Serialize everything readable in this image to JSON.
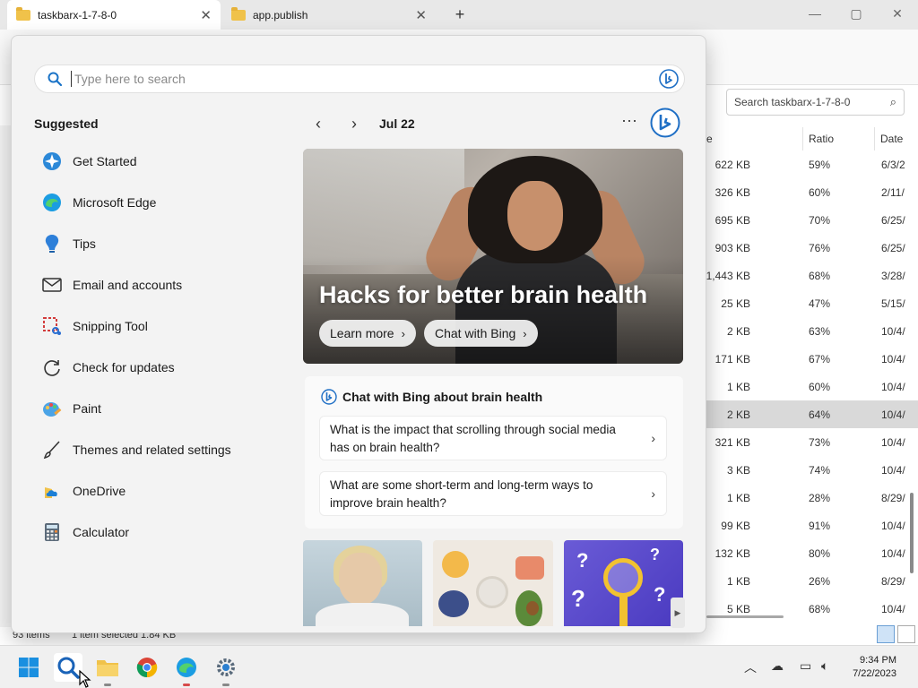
{
  "window": {
    "tabs": [
      {
        "label": "taskbarx-1-7-8-0",
        "close": "✕"
      },
      {
        "label": "app.publish",
        "close": "✕"
      }
    ],
    "new_tab": "+",
    "controls": {
      "minimize": "—",
      "maximize": "▢",
      "close": "✕"
    }
  },
  "explorer": {
    "search_placeholder": "Search taskbarx-1-7-8-0",
    "columns": {
      "size_fragment": "e",
      "ratio": "Ratio",
      "date": "Date"
    },
    "rows": [
      {
        "size": "622 KB",
        "ratio": "59%",
        "date": "6/3/2"
      },
      {
        "size": "326 KB",
        "ratio": "60%",
        "date": "2/11/"
      },
      {
        "size": "695 KB",
        "ratio": "70%",
        "date": "6/25/"
      },
      {
        "size": "903 KB",
        "ratio": "76%",
        "date": "6/25/"
      },
      {
        "size": "1,443 KB",
        "ratio": "68%",
        "date": "3/28/"
      },
      {
        "size": "25 KB",
        "ratio": "47%",
        "date": "5/15/"
      },
      {
        "size": "2 KB",
        "ratio": "63%",
        "date": "10/4/"
      },
      {
        "size": "171 KB",
        "ratio": "67%",
        "date": "10/4/"
      },
      {
        "size": "1 KB",
        "ratio": "60%",
        "date": "10/4/"
      },
      {
        "size": "2 KB",
        "ratio": "64%",
        "date": "10/4/"
      },
      {
        "size": "321 KB",
        "ratio": "73%",
        "date": "10/4/"
      },
      {
        "size": "3 KB",
        "ratio": "74%",
        "date": "10/4/"
      },
      {
        "size": "1 KB",
        "ratio": "28%",
        "date": "8/29/"
      },
      {
        "size": "99 KB",
        "ratio": "91%",
        "date": "10/4/"
      },
      {
        "size": "132 KB",
        "ratio": "80%",
        "date": "10/4/"
      },
      {
        "size": "1 KB",
        "ratio": "26%",
        "date": "8/29/"
      },
      {
        "size": "5 KB",
        "ratio": "68%",
        "date": "10/4/"
      }
    ],
    "status": {
      "items": "93 items",
      "selected": "1 item selected  1.84 KB"
    }
  },
  "search": {
    "placeholder": "Type here to search",
    "suggested_title": "Suggested",
    "apps": [
      {
        "name": "Get Started",
        "icon": "get-started-icon"
      },
      {
        "name": "Microsoft Edge",
        "icon": "edge-icon"
      },
      {
        "name": "Tips",
        "icon": "tips-icon"
      },
      {
        "name": "Email and accounts",
        "icon": "mail-icon"
      },
      {
        "name": "Snipping Tool",
        "icon": "snipping-tool-icon"
      },
      {
        "name": "Check for updates",
        "icon": "refresh-icon"
      },
      {
        "name": "Paint",
        "icon": "paint-icon"
      },
      {
        "name": "Themes and related settings",
        "icon": "brush-icon"
      },
      {
        "name": "OneDrive",
        "icon": "onedrive-icon"
      },
      {
        "name": "Calculator",
        "icon": "calculator-icon"
      }
    ],
    "date_label": "Jul 22",
    "prev": "‹",
    "next": "›",
    "more": "···",
    "hero": {
      "title": "Hacks for better brain health",
      "learn_more": "Learn more",
      "chat_bing": "Chat with Bing",
      "chev": "›"
    },
    "chat": {
      "title": "Chat with Bing about brain health",
      "questions": [
        "What is the impact that scrolling through social media has on brain health?",
        "What are some short-term and long-term ways to improve brain health?"
      ],
      "chev": "›"
    },
    "scroll_right": "▶"
  },
  "taskbar": {
    "time": "9:34 PM",
    "date": "7/22/2023",
    "tray_chevron": "︿"
  },
  "colors": {
    "accent": "#0078d4",
    "flyout_bg": "#f3f3f3",
    "taskbar_bg": "#f0f0f0"
  }
}
